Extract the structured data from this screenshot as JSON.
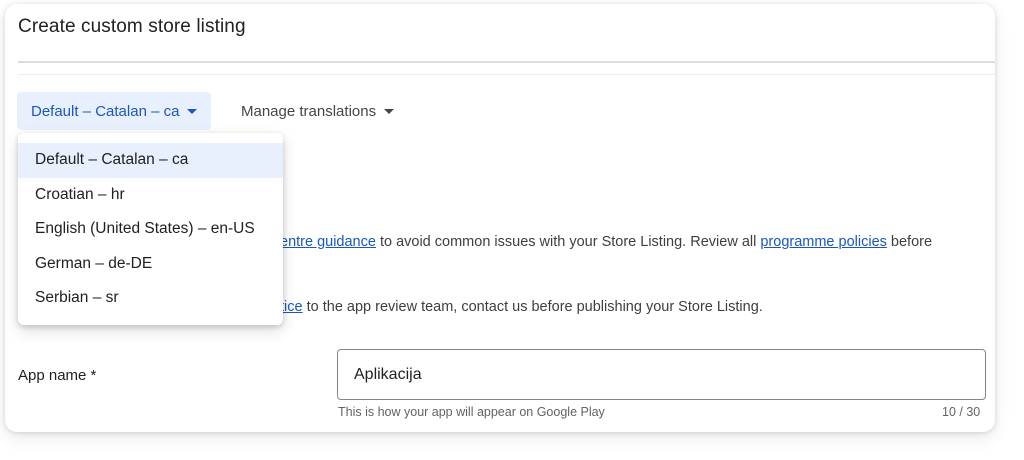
{
  "page": {
    "title": "Create custom store listing"
  },
  "language_select": {
    "value": "Default – Catalan – ca"
  },
  "manage_translations": {
    "label": "Manage translations"
  },
  "dropdown": {
    "options": [
      "Default – Catalan – ca",
      "Croatian – hr",
      "English (United States) – en-US",
      "German – de-DE",
      "Serbian – sr"
    ],
    "selected_index": 0
  },
  "guidance": {
    "line1_link": "entre guidance",
    "line1_text": " to avoid common issues with your Store Listing. Review all ",
    "line1_link2": "programme policies",
    "line1_tail": " before",
    "line2_link": "tice",
    "line2_text": " to the app review team, contact us before publishing your Store Listing."
  },
  "app_name": {
    "label": "App name  *",
    "value": "Aplikacija",
    "helper": "This is how your app will appear on Google Play",
    "counter": "10 / 30"
  },
  "colors": {
    "accent": "#1a56c4",
    "selected_bg": "#e8f0fe"
  }
}
